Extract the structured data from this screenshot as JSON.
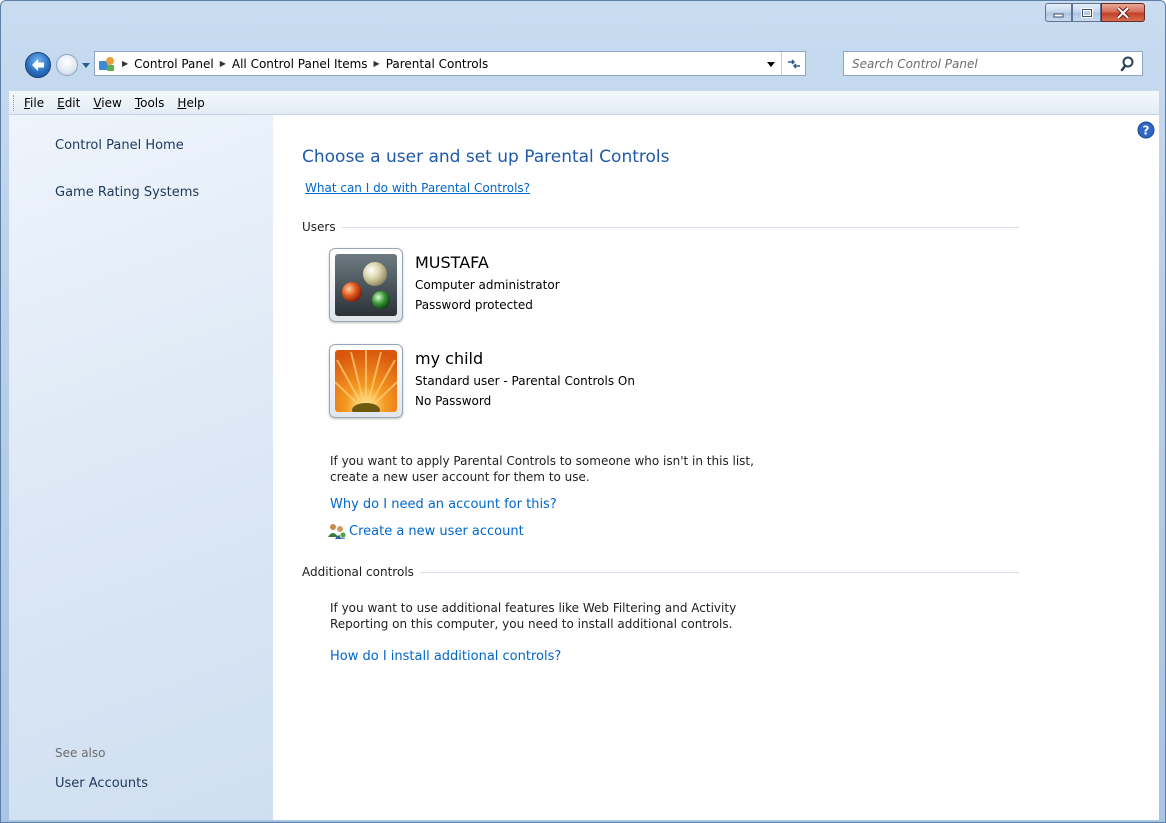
{
  "window": {
    "caption_buttons": [
      "minimize-icon",
      "maximize-icon",
      "close-icon"
    ]
  },
  "address": {
    "breadcrumbs": [
      "Control Panel",
      "All Control Panel Items",
      "Parental Controls"
    ],
    "search_placeholder": "Search Control Panel"
  },
  "menu": {
    "items": [
      {
        "key": "F",
        "rest": "ile"
      },
      {
        "key": "E",
        "rest": "dit"
      },
      {
        "key": "V",
        "rest": "iew"
      },
      {
        "key": "T",
        "rest": "ools"
      },
      {
        "key": "H",
        "rest": "elp"
      }
    ]
  },
  "left_pane": {
    "links": [
      "Control Panel Home",
      "Game Rating Systems"
    ],
    "see_also_label": "See also",
    "see_also_links": [
      "User Accounts"
    ]
  },
  "main": {
    "title": "Choose a user and set up Parental Controls",
    "what_link": "What can I do with Parental Controls?",
    "users_section": "Users",
    "users": [
      {
        "name": "MUSTAFA",
        "line1": "Computer administrator",
        "line2": "Password protected",
        "avatar": "marbles"
      },
      {
        "name": "my child",
        "line1": "Standard user - Parental Controls On",
        "line2": "No Password",
        "avatar": "flower"
      }
    ],
    "info_line1": "If you want to apply Parental Controls to someone who isn't in this list,",
    "info_line2": "create a new user account for them to use.",
    "why_link": "Why do I need an account for this?",
    "create_link": "Create a new user account",
    "additional_section": "Additional controls",
    "additional_line1": "If you want to use additional features like Web Filtering and Activity",
    "additional_line2": "Reporting on this computer, you need to install additional controls.",
    "install_link": "How do I install additional controls?"
  },
  "colors": {
    "link": "#0066cc",
    "title": "#1e5aa8",
    "left_pane_link": "#1e395b"
  }
}
